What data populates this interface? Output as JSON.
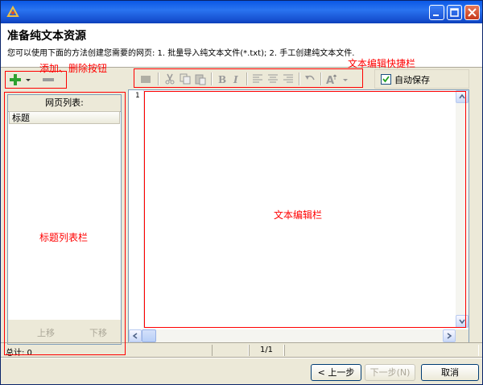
{
  "window": {
    "heading": "准备纯文本资源",
    "description": "您可以使用下面的方法创建您需要的网页: 1. 批量导入纯文本文件(*.txt); 2. 手工创建纯文本文件."
  },
  "title_controls": [
    "minimize-icon",
    "maximize-icon",
    "close-icon"
  ],
  "toolbar": {
    "add_icon": "plus-icon",
    "remove_icon": "minus-icon",
    "autosave_label": "自动保存",
    "autosave_checked": true,
    "edit_icons": [
      "box-icon",
      "cut-icon",
      "copy-icon",
      "paste-icon",
      "bold-icon",
      "italic-icon",
      "align-left-icon",
      "align-center-icon",
      "align-right-icon",
      "undo-icon",
      "font-size-icon"
    ]
  },
  "left_panel": {
    "title": "网页列表:",
    "column_header": "标题",
    "move_up": "上移",
    "move_down": "下移"
  },
  "editor": {
    "line_number": "1"
  },
  "status": {
    "total": "总计: 0",
    "page": "1/1"
  },
  "buttons": {
    "prev": "< 上一步(B)",
    "next": "下一步(N) >",
    "cancel": "取消"
  },
  "annotations": {
    "add_delete": "添加、删除按钮",
    "edit_shortcut": "文本编辑快捷栏",
    "edit_area": "文本编辑栏",
    "title_list": "标题列表栏"
  },
  "colors": {
    "annotation": "#ff0000",
    "titlebar": "#0a58e6"
  }
}
